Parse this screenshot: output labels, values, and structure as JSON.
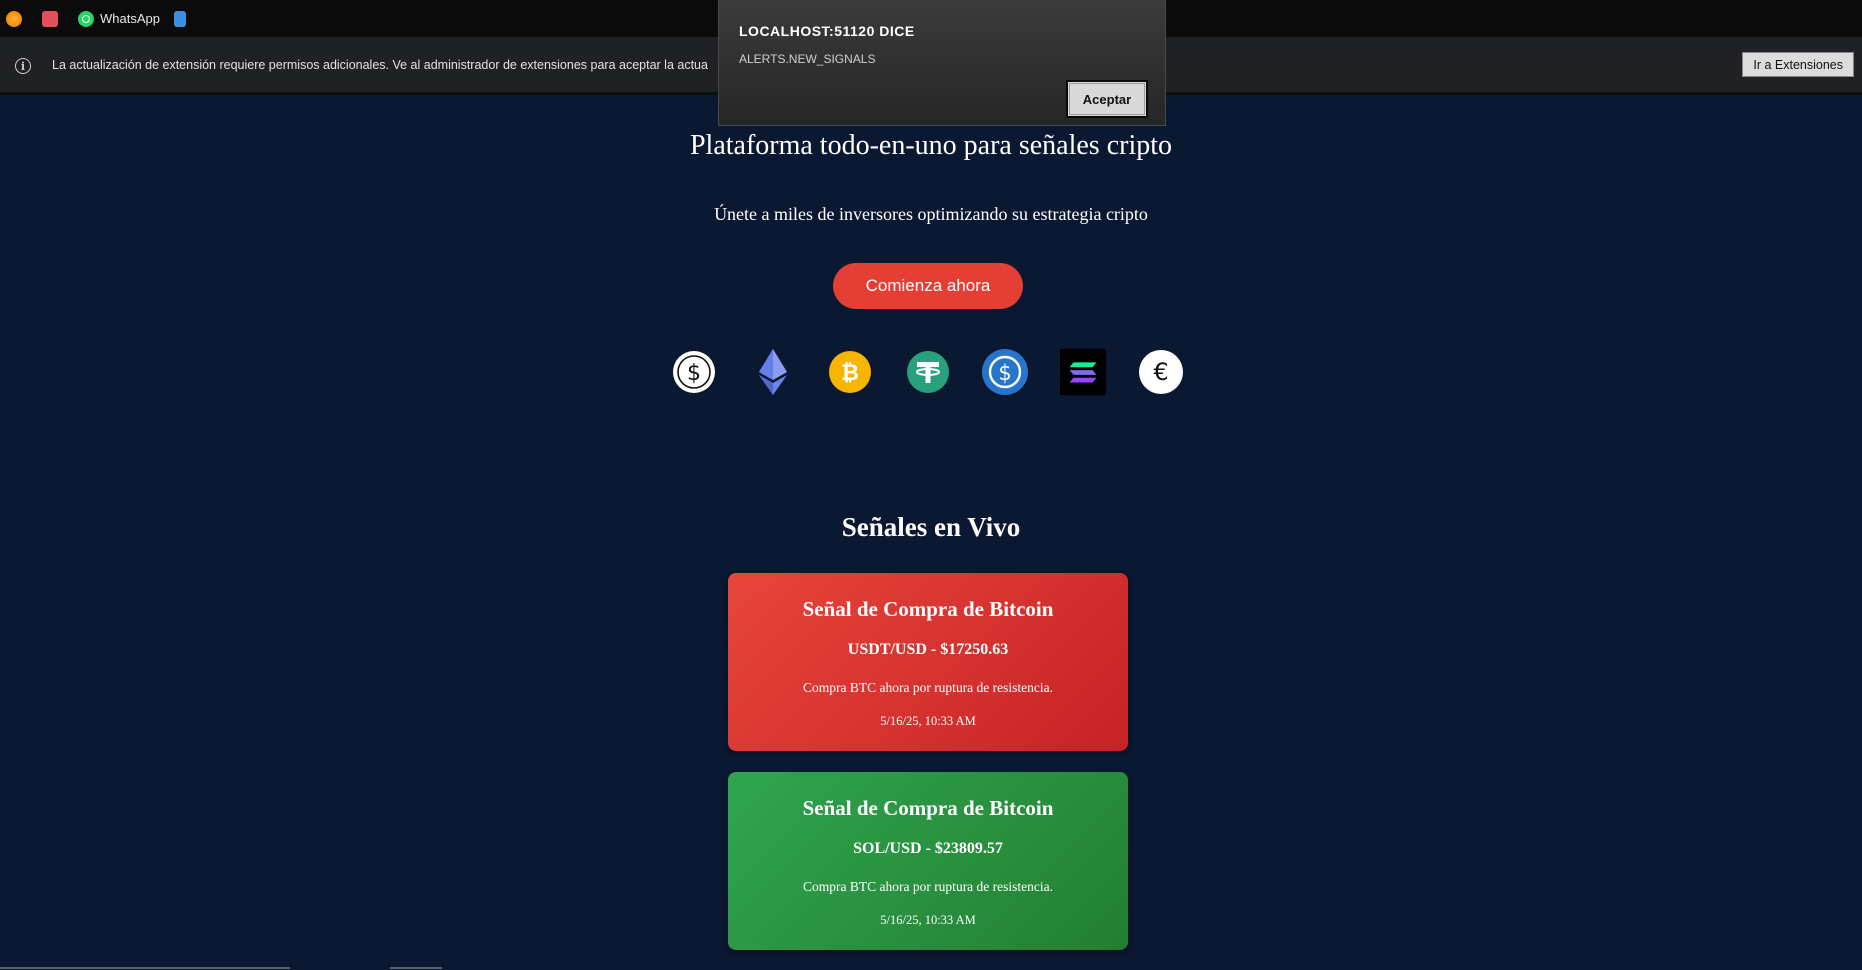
{
  "bookmarks": {
    "items": [
      {
        "label": "",
        "icon": "orange-circle-icon"
      },
      {
        "label": "",
        "icon": "book-icon"
      },
      {
        "label": "WhatsApp",
        "icon": "whatsapp-icon"
      },
      {
        "label": "",
        "icon": "document-icon"
      }
    ]
  },
  "infobar": {
    "message": "La actualización de extensión requiere permisos adicionales. Ve al administrador de extensiones para aceptar la actua",
    "button_label": "Ir a Extensiones"
  },
  "dialog": {
    "title": "LOCALHOST:51120 DICE",
    "message": "ALERTS.NEW_SIGNALS",
    "button_label": "Aceptar"
  },
  "hero": {
    "title": "Plataforma todo-en-uno para señales cripto",
    "subtitle": "Únete a miles de inversores optimizando su estrategia cripto",
    "cta_label": "Comienza ahora"
  },
  "coins": [
    {
      "name": "usd-icon",
      "color": "#ffffff"
    },
    {
      "name": "ethereum-icon",
      "color": "#627eea"
    },
    {
      "name": "bitcoin-icon",
      "color": "#f7b500"
    },
    {
      "name": "tether-icon",
      "color": "#26a17b"
    },
    {
      "name": "usdc-icon",
      "color": "#2775ca"
    },
    {
      "name": "solana-icon",
      "color": "#000000"
    },
    {
      "name": "euro-icon",
      "color": "#ffffff"
    }
  ],
  "signals": {
    "heading": "Señales en Vivo",
    "cards": [
      {
        "title": "Señal de Compra de Bitcoin",
        "pair": "USDT/USD - $17250.63",
        "description": "Compra BTC ahora por ruptura de resistencia.",
        "time": "5/16/25, 10:33 AM",
        "color": "#d9312e"
      },
      {
        "title": "Señal de Compra de Bitcoin",
        "pair": "SOL/USD - $23809.57",
        "description": "Compra BTC ahora por ruptura de resistencia.",
        "time": "5/16/25, 10:33 AM",
        "color": "#2a9143"
      }
    ]
  }
}
